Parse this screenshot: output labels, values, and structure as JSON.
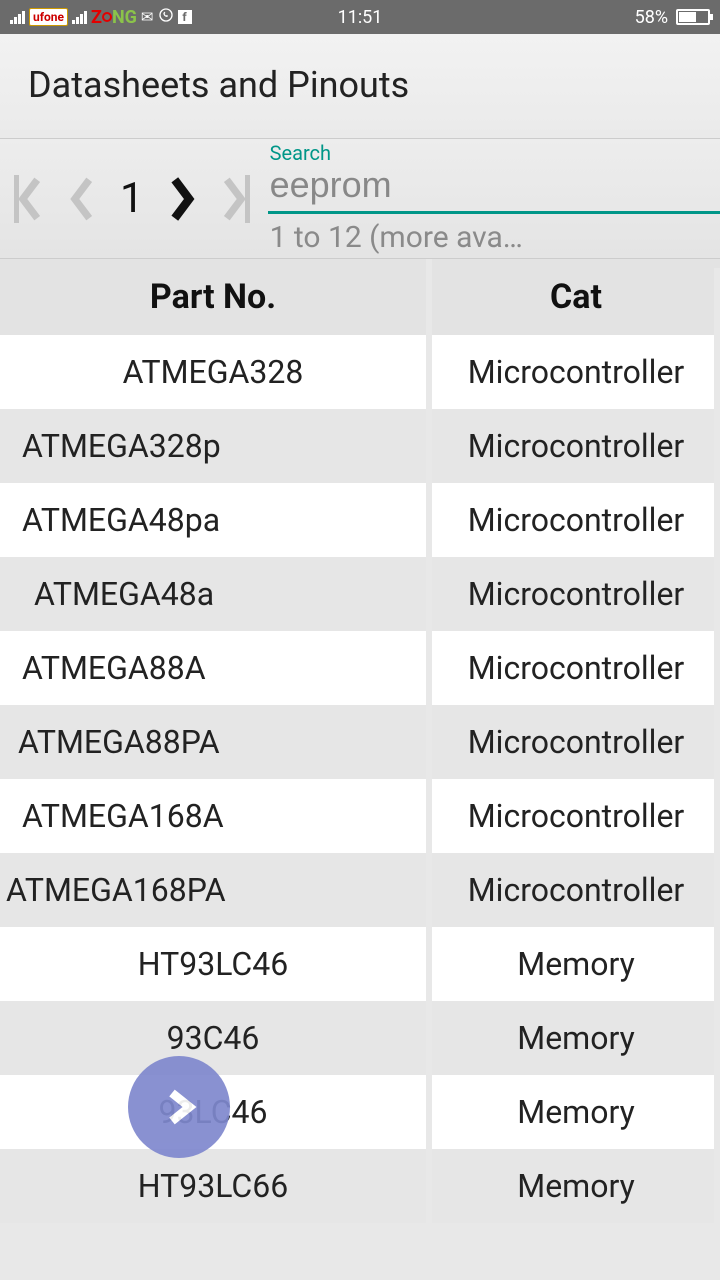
{
  "status": {
    "carrier1": "ufone",
    "time": "11:51",
    "battery_pct": "58%"
  },
  "header": {
    "title": "Datasheets and Pinouts"
  },
  "pager": {
    "current_page": "1"
  },
  "search": {
    "label": "Search",
    "value": "eeprom",
    "result_text": "1 to 12 (more ava…"
  },
  "table": {
    "columns": {
      "part": "Part No.",
      "cat": "Cat"
    },
    "rows": [
      {
        "part": "ATMEGA328",
        "cat": "Microcontroller"
      },
      {
        "part": "ATMEGA328p",
        "cat": "Microcontroller"
      },
      {
        "part": "ATMEGA48pa",
        "cat": "Microcontroller"
      },
      {
        "part": "ATMEGA48a",
        "cat": "Microcontroller"
      },
      {
        "part": "ATMEGA88A",
        "cat": "Microcontroller"
      },
      {
        "part": "ATMEGA88PA",
        "cat": "Microcontroller"
      },
      {
        "part": "ATMEGA168A",
        "cat": "Microcontroller"
      },
      {
        "part": "ATMEGA168PA",
        "cat": "Microcontroller"
      },
      {
        "part": "HT93LC46",
        "cat": "Memory"
      },
      {
        "part": "93C46",
        "cat": "Memory"
      },
      {
        "part": "93LC46",
        "cat": "Memory"
      },
      {
        "part": "HT93LC66",
        "cat": "Memory"
      }
    ]
  }
}
